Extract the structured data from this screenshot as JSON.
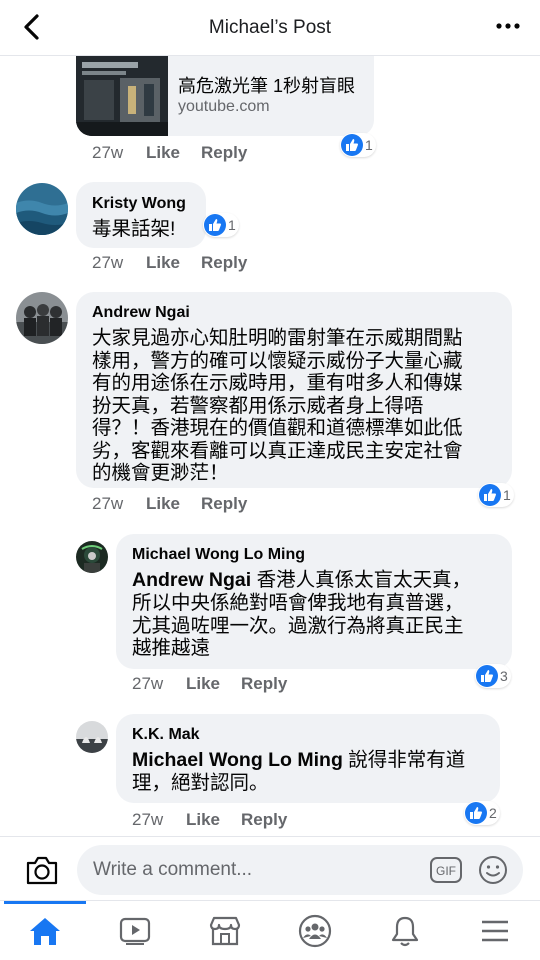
{
  "header": {
    "title": "Michael’s Post"
  },
  "link_preview": {
    "title": "高危激光筆 1秒射盲眼",
    "domain": "youtube.com"
  },
  "top_meta": {
    "time": "27w",
    "like": "Like",
    "reply": "Reply",
    "reactions": "1"
  },
  "comments": [
    {
      "author": "Kristy Wong",
      "lines": [
        "毒果話架!"
      ],
      "time": "27w",
      "like": "Like",
      "reply": "Reply",
      "reactions": "1"
    },
    {
      "author": "Andrew Ngai",
      "lines": [
        "大家見過亦心知肚明啲雷射筆在示威期間點",
        "樣用，警方的確可以懷疑示威份子大量心藏",
        "有的用途係在示威時用，重有咁多人和傳媒",
        "扮天真，若警察都用係示威者身上得唔",
        "得？！香港現在的價值觀和道德標準如此低",
        "劣，客觀來看離可以真正達成民主安定社會",
        "的機會更渺茫！"
      ],
      "time": "27w",
      "like": "Like",
      "reply": "Reply",
      "reactions": "1"
    }
  ],
  "replies": [
    {
      "author": "Michael Wong Lo Ming",
      "mention": "Andrew Ngai",
      "line1_rest": " 香港人真係太盲太天真，",
      "lines": [
        "所以中央係絶對唔會俾我地有真普選，",
        "尤其過咗哩一次。過激行為將真正民主",
        "越推越遠"
      ],
      "time": "27w",
      "like": "Like",
      "reply": "Reply",
      "reactions": "3"
    },
    {
      "author": "K.K. Mak",
      "mention": "Michael Wong Lo Ming",
      "line1_rest": " 說得非常有道",
      "lines": [
        "理，絕對認同。"
      ],
      "time": "27w",
      "like": "Like",
      "reply": "Reply",
      "reactions": "2"
    }
  ],
  "composer": {
    "placeholder": "Write a comment...",
    "gif_label": "GIF"
  },
  "colors": {
    "accent": "#1877f2",
    "bubble": "#f0f2f5",
    "meta": "#65676b"
  },
  "icons": [
    "back-arrow-icon",
    "more-dots-icon",
    "like-thumb-icon",
    "camera-icon",
    "gif-icon",
    "emoji-icon",
    "home-icon",
    "watch-icon",
    "marketplace-icon",
    "groups-icon",
    "bell-icon",
    "menu-icon"
  ]
}
